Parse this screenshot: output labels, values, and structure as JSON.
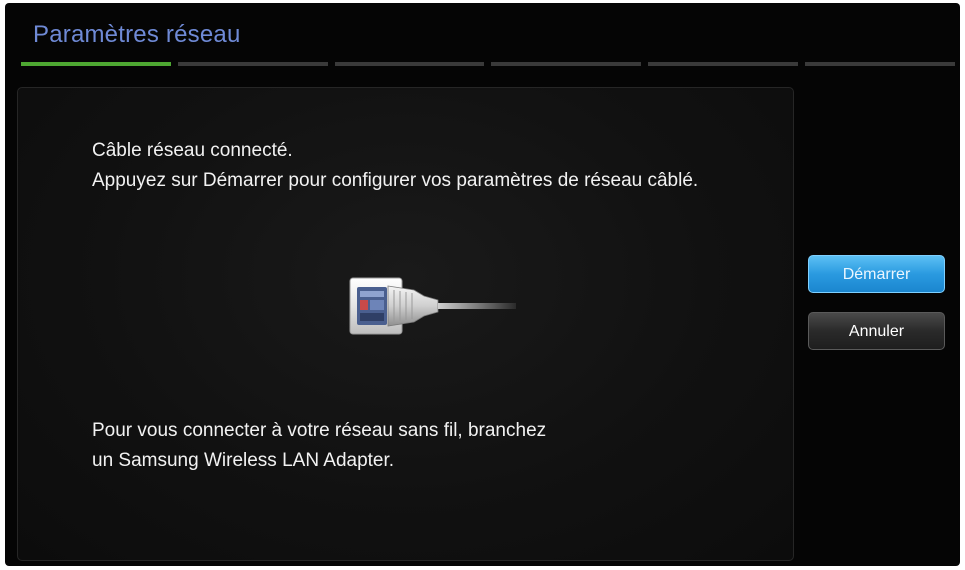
{
  "window": {
    "title": "Paramètres réseau",
    "progress": {
      "total_steps": 6,
      "current_step": 1
    }
  },
  "content": {
    "status_line": "Câble réseau connecté.",
    "instruction_line": "Appuyez sur Démarrer pour configurer vos paramètres de réseau câblé.",
    "wireless_hint_line1": "Pour vous connecter à votre réseau sans fil, branchez",
    "wireless_hint_line2": "un Samsung Wireless LAN Adapter.",
    "illustration_icon": "ethernet-cable-icon"
  },
  "buttons": {
    "start_label": "Démarrer",
    "cancel_label": "Annuler"
  },
  "colors": {
    "title": "#6f8ad6",
    "progress_active": "#4ea832",
    "progress_inactive": "#3a3a3a",
    "start_button": "#2a9ae0",
    "background": "#050505"
  }
}
